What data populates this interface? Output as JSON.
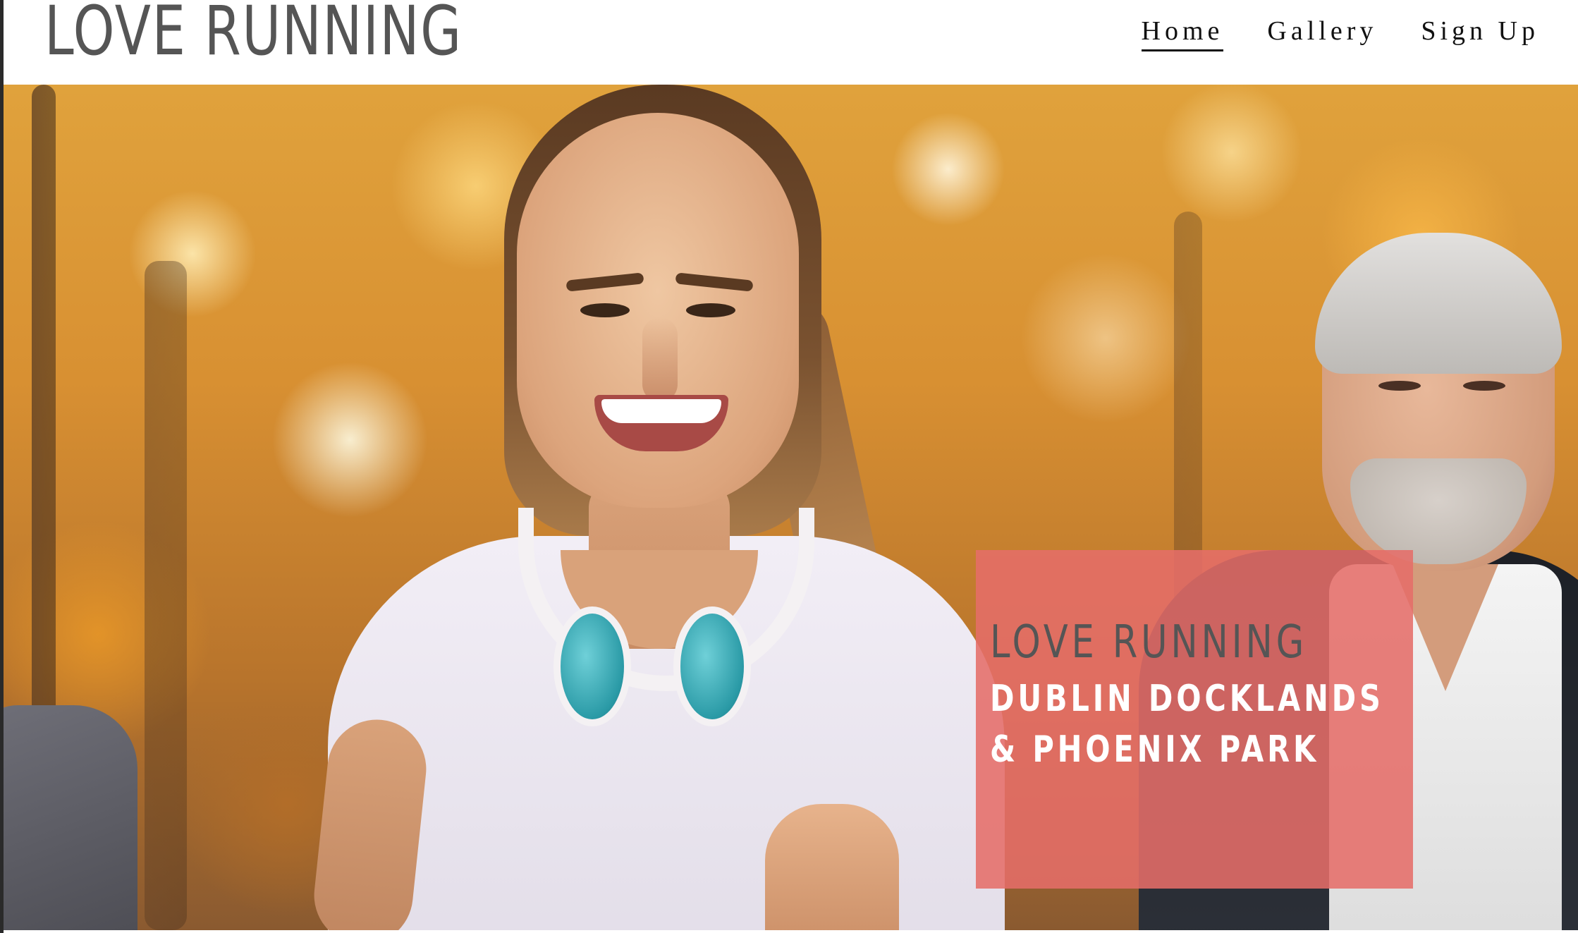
{
  "site": {
    "logo_text": "LOVE RUNNING"
  },
  "nav": {
    "items": [
      {
        "label": "Home",
        "active": true
      },
      {
        "label": "Gallery",
        "active": false
      },
      {
        "label": "Sign Up",
        "active": false
      }
    ]
  },
  "hero": {
    "image_subject": "smiling woman with headphones jogging, older man beside her, autumn trees",
    "caption": {
      "title": "LOVE RUNNING",
      "subtitle": "DUBLIN DOCKLANDS & PHOENIX PARK"
    }
  },
  "colors": {
    "logo_text": "#555555",
    "nav_text": "#111111",
    "caption_background": "#e56d69",
    "caption_title": "#555555",
    "caption_subtitle": "#ffffff"
  }
}
